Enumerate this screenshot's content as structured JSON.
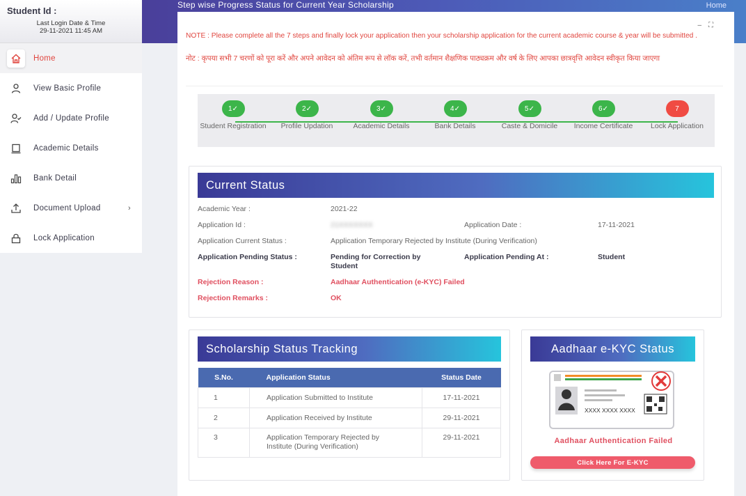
{
  "sidebar": {
    "student_id_label": "Student Id :",
    "last_login_label": "Last Login Date & Time",
    "last_login_value": "29-11-2021 11:45 AM",
    "items": [
      {
        "label": "Home",
        "icon": "home-icon"
      },
      {
        "label": "View Basic Profile",
        "icon": "user-icon"
      },
      {
        "label": "Add / Update Profile",
        "icon": "user-check-icon"
      },
      {
        "label": "Academic Details",
        "icon": "laptop-icon"
      },
      {
        "label": "Bank Detail",
        "icon": "bar-chart-icon"
      },
      {
        "label": "Document Upload",
        "icon": "upload-icon"
      },
      {
        "label": "Lock Application",
        "icon": "lock-icon"
      }
    ]
  },
  "header": {
    "title": "Step wise Progress Status for Current Year Scholarship",
    "home": "Home"
  },
  "notes": {
    "english": "NOTE : Please complete all the 7 steps and finally lock your application then your scholarship application for the current academic course & year will be submitted .",
    "hindi": "नोट : कृपया सभी 7 चरणों को पूरा करें और अपने आवेदन को अंतिम रूप से लॉक करें, तभी वर्तमान शैक्षणिक पाठ्यक्रम और वर्ष के लिए आपका छात्रवृत्ति आवेदन स्वीकृत किया जाएगा"
  },
  "steps": [
    {
      "num": "1✓",
      "label": "Student Registration",
      "done": true
    },
    {
      "num": "2✓",
      "label": "Profile Updation",
      "done": true
    },
    {
      "num": "3✓",
      "label": "Academic Details",
      "done": true
    },
    {
      "num": "4✓",
      "label": "Bank Details",
      "done": true
    },
    {
      "num": "5✓",
      "label": "Caste & Domicile",
      "done": true
    },
    {
      "num": "6✓",
      "label": "Income Certificate",
      "done": true
    },
    {
      "num": "7",
      "label": "Lock Application",
      "done": false
    }
  ],
  "current_status": {
    "title": "Current Status",
    "academic_year_label": "Academic Year :",
    "academic_year": "2021-22",
    "application_id_label": "Application Id :",
    "application_id": "21XXXXXXX",
    "application_date_label": "Application Date :",
    "application_date": "17-11-2021",
    "current_status_label": "Application Current Status :",
    "current_status_value": "Application Temporary Rejected by Institute (During Verification)",
    "pending_status_label": "Application Pending Status :",
    "pending_status_value": "Pending for Correction by Student",
    "pending_at_label": "Application Pending At :",
    "pending_at_value": "Student",
    "rejection_reason_label": "Rejection Reason :",
    "rejection_reason": "Aadhaar Authentication (e-KYC) Failed",
    "rejection_remarks_label": "Rejection Remarks :",
    "rejection_remarks": "OK"
  },
  "tracking": {
    "title": "Scholarship Status Tracking",
    "columns": [
      "S.No.",
      "Application Status",
      "Status Date"
    ],
    "rows": [
      {
        "sno": "1",
        "status": "Application Submitted to Institute",
        "date": "17-11-2021"
      },
      {
        "sno": "2",
        "status": "Application Received by Institute",
        "date": "29-11-2021"
      },
      {
        "sno": "3",
        "status": "Application Temporary Rejected by Institute (During Verification)",
        "date": "29-11-2021"
      }
    ]
  },
  "aadhaar": {
    "title": "Aadhaar e-KYC Status",
    "card_number": "XXXX XXXX XXXX",
    "status": "Aadhaar Authentication Failed",
    "button": "Click Here For E-KYC"
  },
  "colors": {
    "accent_red": "#e0453e",
    "step_green": "#3cb54a",
    "header_gradient_start": "#3a3a96",
    "header_gradient_end": "#26c4dc"
  }
}
